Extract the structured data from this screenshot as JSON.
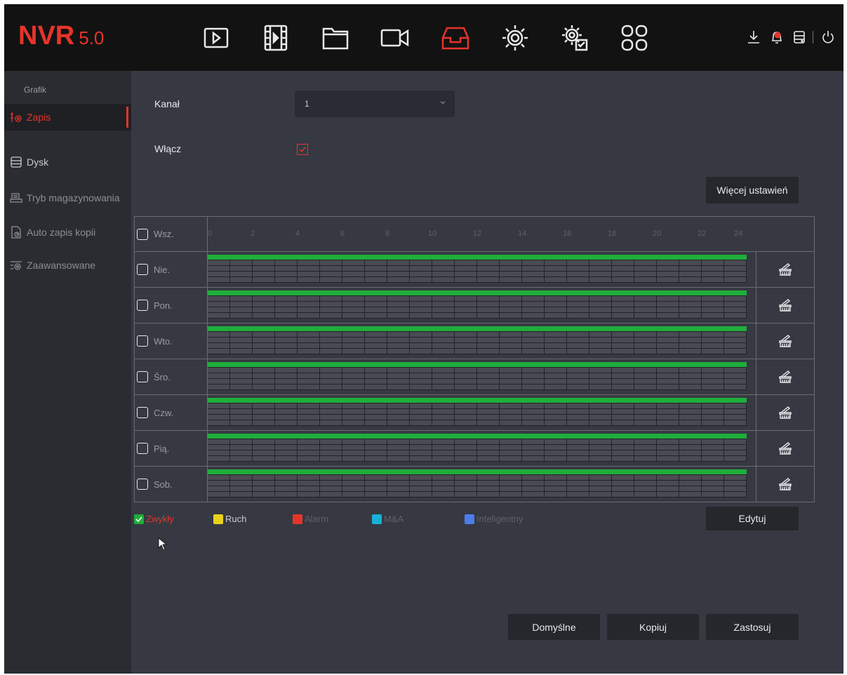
{
  "app": {
    "logo_bold": "NVR",
    "logo_version": "5.0"
  },
  "topnav": {
    "icons": [
      "playback-icon",
      "video-clip-icon",
      "folder-icon",
      "camera-icon",
      "storage-icon",
      "settings-icon",
      "advanced-settings-icon",
      "apps-icon"
    ],
    "active": "storage-icon",
    "accent": "#e6342a"
  },
  "topright": {
    "icons": [
      "download-icon",
      "alarm-bell-icon",
      "hdd-icon",
      "power-icon"
    ]
  },
  "sidebar": {
    "header": "Grafik",
    "items": [
      {
        "label": "Zapis",
        "icon": "record-schedule-icon",
        "active": true
      },
      {
        "label": "Dysk",
        "icon": "disk-icon"
      },
      {
        "label": "Tryb magazynowania",
        "icon": "storage-mode-icon"
      },
      {
        "label": "Auto zapis kopii",
        "icon": "auto-backup-icon"
      },
      {
        "label": "Zaawansowane",
        "icon": "advanced-icon"
      }
    ]
  },
  "form": {
    "channel_label": "Kanał",
    "channel_value": "1",
    "enable_label": "Włącz",
    "enable_checked": true,
    "more_settings": "Więcej ustawień"
  },
  "schedule": {
    "all_label": "Wsz.",
    "hours": [
      "0",
      "2",
      "4",
      "6",
      "8",
      "10",
      "12",
      "14",
      "16",
      "18",
      "20",
      "22",
      "24"
    ],
    "days": [
      "Nie.",
      "Pon.",
      "Wto.",
      "Śro.",
      "Czw.",
      "Pią.",
      "Sob."
    ],
    "recording_type": "Zwykły",
    "recording_color": "#1fae3b",
    "coverage_hours": [
      0,
      24
    ]
  },
  "legend": [
    {
      "label": "Zwykły",
      "color": "#1fae3b",
      "text_color": "#e6342a",
      "checked": true
    },
    {
      "label": "Ruch",
      "color": "#e8d31a",
      "text_color": "#c9cbd0"
    },
    {
      "label": "Alarm",
      "color": "#e6342a",
      "text_color": "#5e6069"
    },
    {
      "label": "M&A",
      "color": "#19b0d6",
      "text_color": "#5e6069"
    },
    {
      "label": "Inteligentny",
      "color": "#4c7bea",
      "text_color": "#5e6069"
    }
  ],
  "buttons": {
    "edit": "Edytuj",
    "default": "Domyślne",
    "copy": "Kopiuj",
    "apply": "Zastosuj"
  }
}
